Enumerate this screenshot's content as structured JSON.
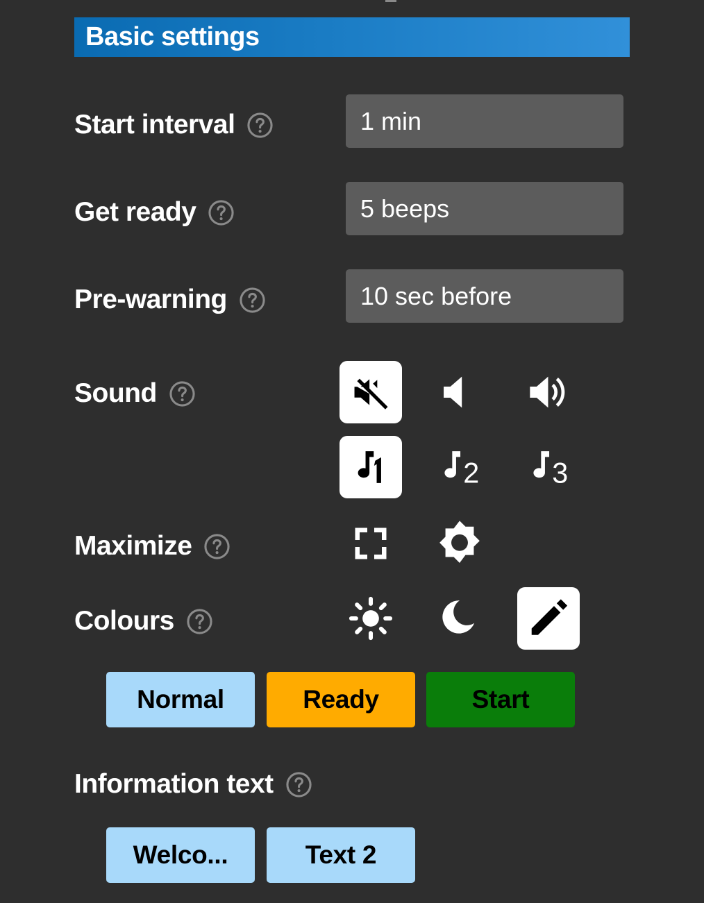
{
  "header": {
    "title": "Basic settings",
    "gradient_from": "#0a6bb2",
    "gradient_to": "#3190d9"
  },
  "theme": {
    "background": "#2e2e2e",
    "value_box": "#5c5c5c",
    "label_text": "#ffffff",
    "help_icon": "#8a8a8a",
    "selected_chip": "#ffffff",
    "icon": "#ffffff"
  },
  "settings": [
    {
      "label": "Start interval",
      "help_icon": "help-circle-icon",
      "value": "1 min"
    },
    {
      "label": "Get ready",
      "help_icon": "help-circle-icon",
      "value": "5 beeps"
    },
    {
      "label": "Pre-warning",
      "help_icon": "help-circle-icon",
      "value": "10 sec before"
    }
  ],
  "sound": {
    "label": "Sound",
    "help_icon": "help-circle-icon",
    "volume_options": [
      {
        "icon": "volume-mute-icon",
        "selected": true
      },
      {
        "icon": "volume-low-icon",
        "selected": false
      },
      {
        "icon": "volume-high-icon",
        "selected": false
      }
    ],
    "tone_options": [
      {
        "icon": "music-note-1-icon",
        "number": "1",
        "selected": true
      },
      {
        "icon": "music-note-2-icon",
        "number": "2",
        "selected": false
      },
      {
        "icon": "music-note-3-icon",
        "number": "3",
        "selected": false
      }
    ]
  },
  "maximize": {
    "label": "Maximize",
    "help_icon": "help-circle-icon",
    "options": [
      {
        "icon": "fullscreen-icon",
        "selected": false
      },
      {
        "icon": "brightness-burst-icon",
        "selected": false
      }
    ]
  },
  "colours": {
    "label": "Colours",
    "help_icon": "help-circle-icon",
    "options": [
      {
        "icon": "sun-icon",
        "selected": false
      },
      {
        "icon": "moon-icon",
        "selected": false
      },
      {
        "icon": "pencil-icon",
        "selected": true
      }
    ],
    "buttons": [
      {
        "label": "Normal",
        "color": "#a8d9fa"
      },
      {
        "label": "Ready",
        "color": "#ffab00"
      },
      {
        "label": "Start",
        "color": "#0a7d0a"
      }
    ]
  },
  "information_text": {
    "label": "Information text",
    "help_icon": "help-circle-icon",
    "buttons": [
      {
        "label": "Welco...",
        "color": "#a8d9fa"
      },
      {
        "label": "Text 2",
        "color": "#a8d9fa"
      }
    ]
  }
}
